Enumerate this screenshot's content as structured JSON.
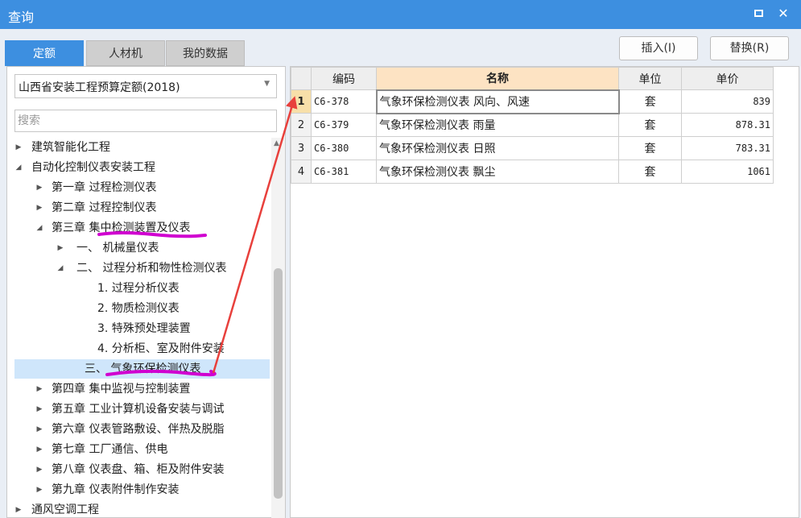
{
  "window": {
    "title": "查询"
  },
  "tabs": [
    {
      "label": "定额",
      "active": true
    },
    {
      "label": "人材机",
      "active": false
    },
    {
      "label": "我的数据",
      "active": false
    }
  ],
  "toolbar": {
    "insert_label": "插入(I)",
    "replace_label": "替换(R)"
  },
  "left": {
    "quota_selected": "山西省安装工程预算定额(2018)",
    "search_placeholder": "搜索",
    "tree": [
      {
        "label": "建筑智能化工程",
        "level": 0,
        "toggle": "▶"
      },
      {
        "label": "自动化控制仪表安装工程",
        "level": 0,
        "toggle": "◢"
      },
      {
        "label": "第一章 过程检测仪表",
        "level": 1,
        "toggle": "▶"
      },
      {
        "label": "第二章 过程控制仪表",
        "level": 1,
        "toggle": "▶"
      },
      {
        "label": "第三章 集中检测装置及仪表",
        "level": 1,
        "toggle": "◢"
      },
      {
        "label": "一、 机械量仪表",
        "level": 2,
        "toggle": "▶"
      },
      {
        "label": "二、 过程分析和物性检测仪表",
        "level": 2,
        "toggle": "◢"
      },
      {
        "label": "1. 过程分析仪表",
        "level": 3,
        "toggle": ""
      },
      {
        "label": "2. 物质检测仪表",
        "level": 3,
        "toggle": ""
      },
      {
        "label": "3. 特殊预处理装置",
        "level": 3,
        "toggle": ""
      },
      {
        "label": "4. 分析柜、室及附件安装",
        "level": 3,
        "toggle": ""
      },
      {
        "label": "三、 气象环保检测仪表",
        "level": 2,
        "toggle": "",
        "selected": true
      },
      {
        "label": "第四章 集中监视与控制装置",
        "level": 1,
        "toggle": "▶"
      },
      {
        "label": "第五章 工业计算机设备安装与调试",
        "level": 1,
        "toggle": "▶"
      },
      {
        "label": "第六章 仪表管路敷设、伴热及脱脂",
        "level": 1,
        "toggle": "▶"
      },
      {
        "label": "第七章 工厂通信、供电",
        "level": 1,
        "toggle": "▶"
      },
      {
        "label": "第八章 仪表盘、箱、柜及附件安装",
        "level": 1,
        "toggle": "▶"
      },
      {
        "label": "第九章 仪表附件制作安装",
        "level": 1,
        "toggle": "▶"
      },
      {
        "label": "通风空调工程",
        "level": 0,
        "toggle": "▶"
      }
    ]
  },
  "grid": {
    "headers": {
      "code": "编码",
      "name": "名称",
      "unit": "单位",
      "price": "单价"
    },
    "rows": [
      {
        "no": "1",
        "code": "C6-378",
        "name": "气象环保检测仪表 风向、风速",
        "unit": "套",
        "price": "839"
      },
      {
        "no": "2",
        "code": "C6-379",
        "name": "气象环保检测仪表 雨量",
        "unit": "套",
        "price": "878.31"
      },
      {
        "no": "3",
        "code": "C6-380",
        "name": "气象环保检测仪表 日照",
        "unit": "套",
        "price": "783.31"
      },
      {
        "no": "4",
        "code": "C6-381",
        "name": "气象环保检测仪表 飘尘",
        "unit": "套",
        "price": "1061"
      }
    ]
  },
  "colors": {
    "accent": "#3d8fe0",
    "highlight": "#cfe6fb",
    "annotation_arrow": "#e8403c",
    "annotation_underline": "#d000d0"
  }
}
